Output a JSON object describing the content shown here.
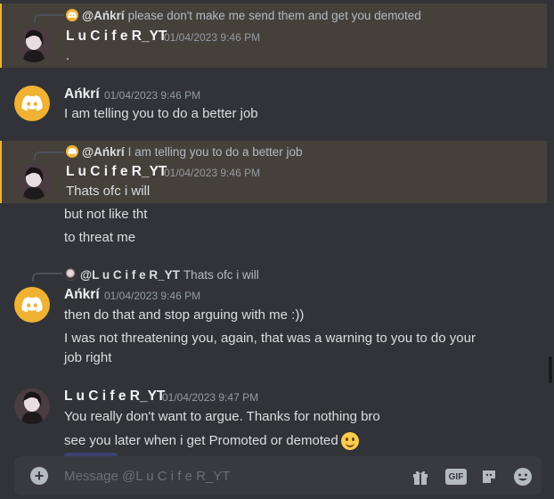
{
  "messages": [
    {
      "reply_name": "@Ańkrí",
      "reply_text": "please don't make me send them and get you demoted",
      "author": "L u C i f e R_YT",
      "timestamp": "01/04/2023 9:46 PM",
      "lines": [
        "."
      ]
    },
    {
      "author": "Ańkrí",
      "timestamp": "01/04/2023 9:46 PM",
      "lines": [
        "I am telling you to do a better job"
      ]
    },
    {
      "reply_name": "@Ańkrí",
      "reply_text": "I am telling you to do a better job",
      "author": "L u C i f e R_YT",
      "timestamp": "01/04/2023 9:46 PM",
      "lines": [
        "Thats ofc i will",
        "but not like tht",
        "to threat me"
      ]
    },
    {
      "reply_name": "@L u C i f e R_YT",
      "reply_text": "Thats ofc i will",
      "author": "Ańkrí",
      "timestamp": "01/04/2023 9:46 PM",
      "lines": [
        "then do that and stop arguing with me :))",
        "I was not threatening you, again, that was a warning to you to do your",
        "job right"
      ]
    },
    {
      "author": "L u C i f e R_YT",
      "timestamp": "01/04/2023 9:47 PM",
      "lines": [
        "You really don't want to argue. Thanks for nothing bro",
        "see you later when i get Promoted or demoted"
      ]
    }
  ],
  "composer": {
    "placeholder": "Message @L u C i f e R_YT"
  },
  "icons": {
    "discord_avatar": "discord-logo-icon",
    "attach": "plus-icon",
    "gift": "gift-icon",
    "gif": "GIF",
    "sticker": "sticker-icon",
    "emoji": "emoji-icon",
    "smile_emoji": "slightly-smiling-face-emoji"
  },
  "colors": {
    "highlight": "#45403a",
    "accent": "#f0b232",
    "background": "#313338"
  }
}
